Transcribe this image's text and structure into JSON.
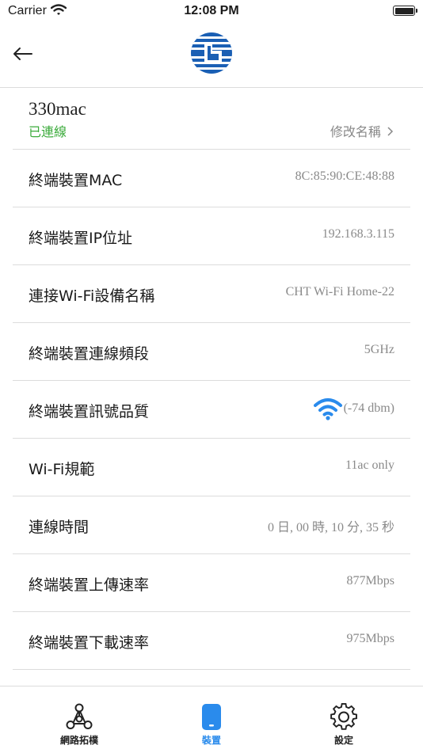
{
  "status_bar": {
    "carrier": "Carrier",
    "time": "12:08 PM"
  },
  "device": {
    "name": "330mac",
    "status": "已連線",
    "rename_label": "修改名稱",
    "status_color": "#3bab3b"
  },
  "rows": [
    {
      "label": "終端裝置MAC",
      "value": "8C:85:90:CE:48:88"
    },
    {
      "label": "終端裝置IP位址",
      "value": "192.168.3.115"
    },
    {
      "label": "連接Wi-Fi設備名稱",
      "value": "CHT Wi-Fi Home-22"
    },
    {
      "label": "終端裝置連線頻段",
      "value": "5GHz"
    },
    {
      "label": "終端裝置訊號品質",
      "value": "(-74 dbm)",
      "icon": "wifi-signal-icon"
    },
    {
      "label": "Wi-Fi規範",
      "value": "11ac only"
    },
    {
      "label": "連線時間",
      "value": "0 日, 00 時, 10 分, 35 秒"
    },
    {
      "label": "終端裝置上傳速率",
      "value": "877Mbps"
    },
    {
      "label": "終端裝置下載速率",
      "value": "975Mbps"
    }
  ],
  "tabs": [
    {
      "label": "網路拓樸",
      "icon": "network-topology-icon",
      "active": false
    },
    {
      "label": "裝置",
      "icon": "device-icon",
      "active": true
    },
    {
      "label": "設定",
      "icon": "gear-icon",
      "active": false
    }
  ],
  "colors": {
    "accent": "#2a8bec",
    "logo_blue": "#1a5fb4",
    "divider": "#dcdcdc"
  }
}
